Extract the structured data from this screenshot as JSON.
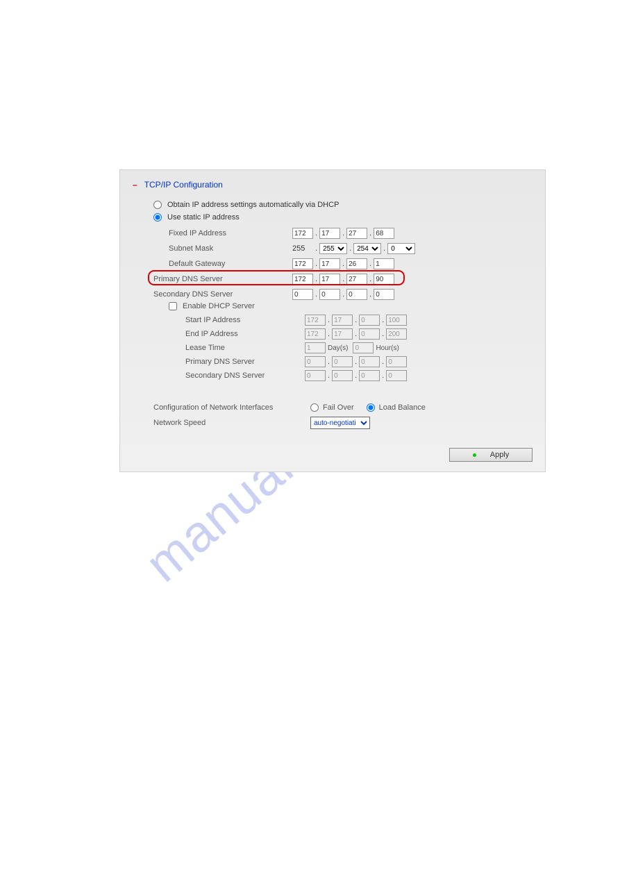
{
  "watermark": "manualshive.com",
  "section": {
    "collapse_glyph": "–",
    "title": "TCP/IP Configuration"
  },
  "radios": {
    "dhcp": "Obtain IP address settings automatically via DHCP",
    "static": "Use static IP address"
  },
  "fields": {
    "fixed_ip": {
      "label": "Fixed IP Address",
      "o1": "172",
      "o2": "17",
      "o3": "27",
      "o4": "68"
    },
    "subnet": {
      "label": "Subnet Mask",
      "s1": "255",
      "o2": "255",
      "o3": "254",
      "o4": "0"
    },
    "gateway": {
      "label": "Default Gateway",
      "o1": "172",
      "o2": "17",
      "o3": "26",
      "o4": "1"
    },
    "dns1": {
      "label": "Primary DNS Server",
      "o1": "172",
      "o2": "17",
      "o3": "27",
      "o4": "90"
    },
    "dns2": {
      "label": "Secondary DNS Server",
      "o1": "0",
      "o2": "0",
      "o3": "0",
      "o4": "0"
    }
  },
  "dhcp_server": {
    "enable_label": "Enable DHCP Server",
    "start_ip": {
      "label": "Start IP Address",
      "o1": "172",
      "o2": "17",
      "o3": "0",
      "o4": "100"
    },
    "end_ip": {
      "label": "End IP Address",
      "o1": "172",
      "o2": "17",
      "o3": "0",
      "o4": "200"
    },
    "lease": {
      "label": "Lease Time",
      "days": "1",
      "days_unit": "Day(s)",
      "hours": "0",
      "hours_unit": "Hour(s)"
    },
    "dns1": {
      "label": "Primary DNS Server",
      "o1": "0",
      "o2": "0",
      "o3": "0",
      "o4": "0"
    },
    "dns2": {
      "label": "Secondary DNS Server",
      "o1": "0",
      "o2": "0",
      "o3": "0",
      "o4": "0"
    }
  },
  "net_if": {
    "label": "Configuration of Network Interfaces",
    "failover": "Fail Over",
    "loadbalance": "Load Balance"
  },
  "net_speed": {
    "label": "Network Speed",
    "value": "auto-negotiati"
  },
  "apply": "Apply"
}
